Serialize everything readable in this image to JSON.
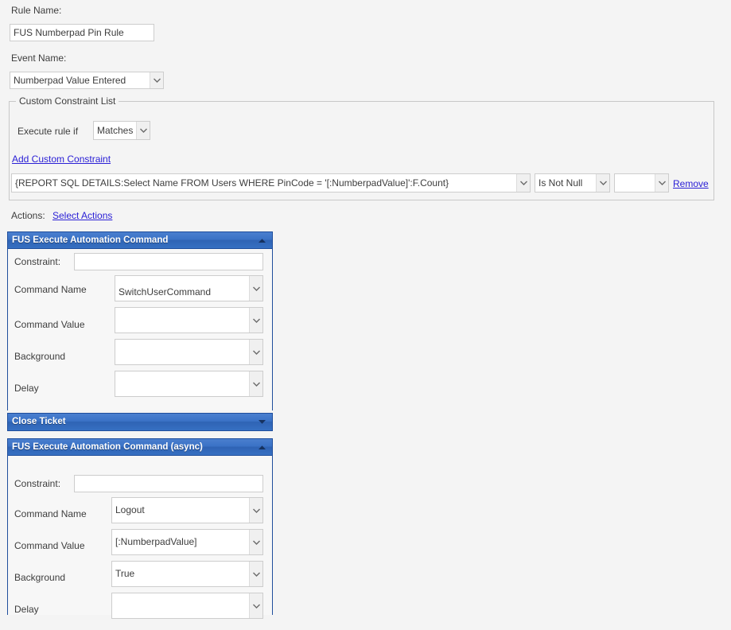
{
  "form": {
    "rule_name_label": "Rule Name:",
    "rule_name_value": "FUS Numberpad Pin Rule",
    "event_name_label": "Event Name:",
    "event_name_value": "Numberpad Value Entered"
  },
  "custom_constraint_list": {
    "legend": "Custom Constraint List",
    "execute_rule_if_label": "Execute rule if",
    "execute_rule_if_value": "Matches",
    "add_link": "Add Custom Constraint",
    "rows": [
      {
        "expression": "{REPORT SQL DETAILS:Select Name FROM Users WHERE PinCode = '[:NumberpadValue]':F.Count}",
        "operator": "Is Not Null",
        "value": "",
        "remove_label": "Remove"
      }
    ]
  },
  "actions": {
    "label": "Actions:",
    "select_actions_link": "Select Actions",
    "field_labels": {
      "constraint": "Constraint:",
      "command_name": "Command Name",
      "command_value": "Command Value",
      "background": "Background",
      "delay": "Delay"
    },
    "panels": [
      {
        "title": "FUS Execute Automation Command",
        "expanded": true,
        "constraint": "",
        "command_name": "SwitchUserCommand",
        "command_value": "",
        "background": "",
        "delay": ""
      },
      {
        "title": "Close Ticket",
        "expanded": false
      },
      {
        "title": "FUS Execute Automation Command (async)",
        "expanded": true,
        "constraint": "",
        "command_name": "Logout",
        "command_value": "[:NumberpadValue]",
        "background": "True",
        "delay": ""
      }
    ]
  },
  "colors": {
    "page_background": "#f4f4f4",
    "panel_header_blue": "#3a72c6",
    "panel_border_blue": "#1f4e9c",
    "link_blue": "#2b20d6",
    "text": "#3d3d3d",
    "input_border": "#cdcdcd"
  }
}
